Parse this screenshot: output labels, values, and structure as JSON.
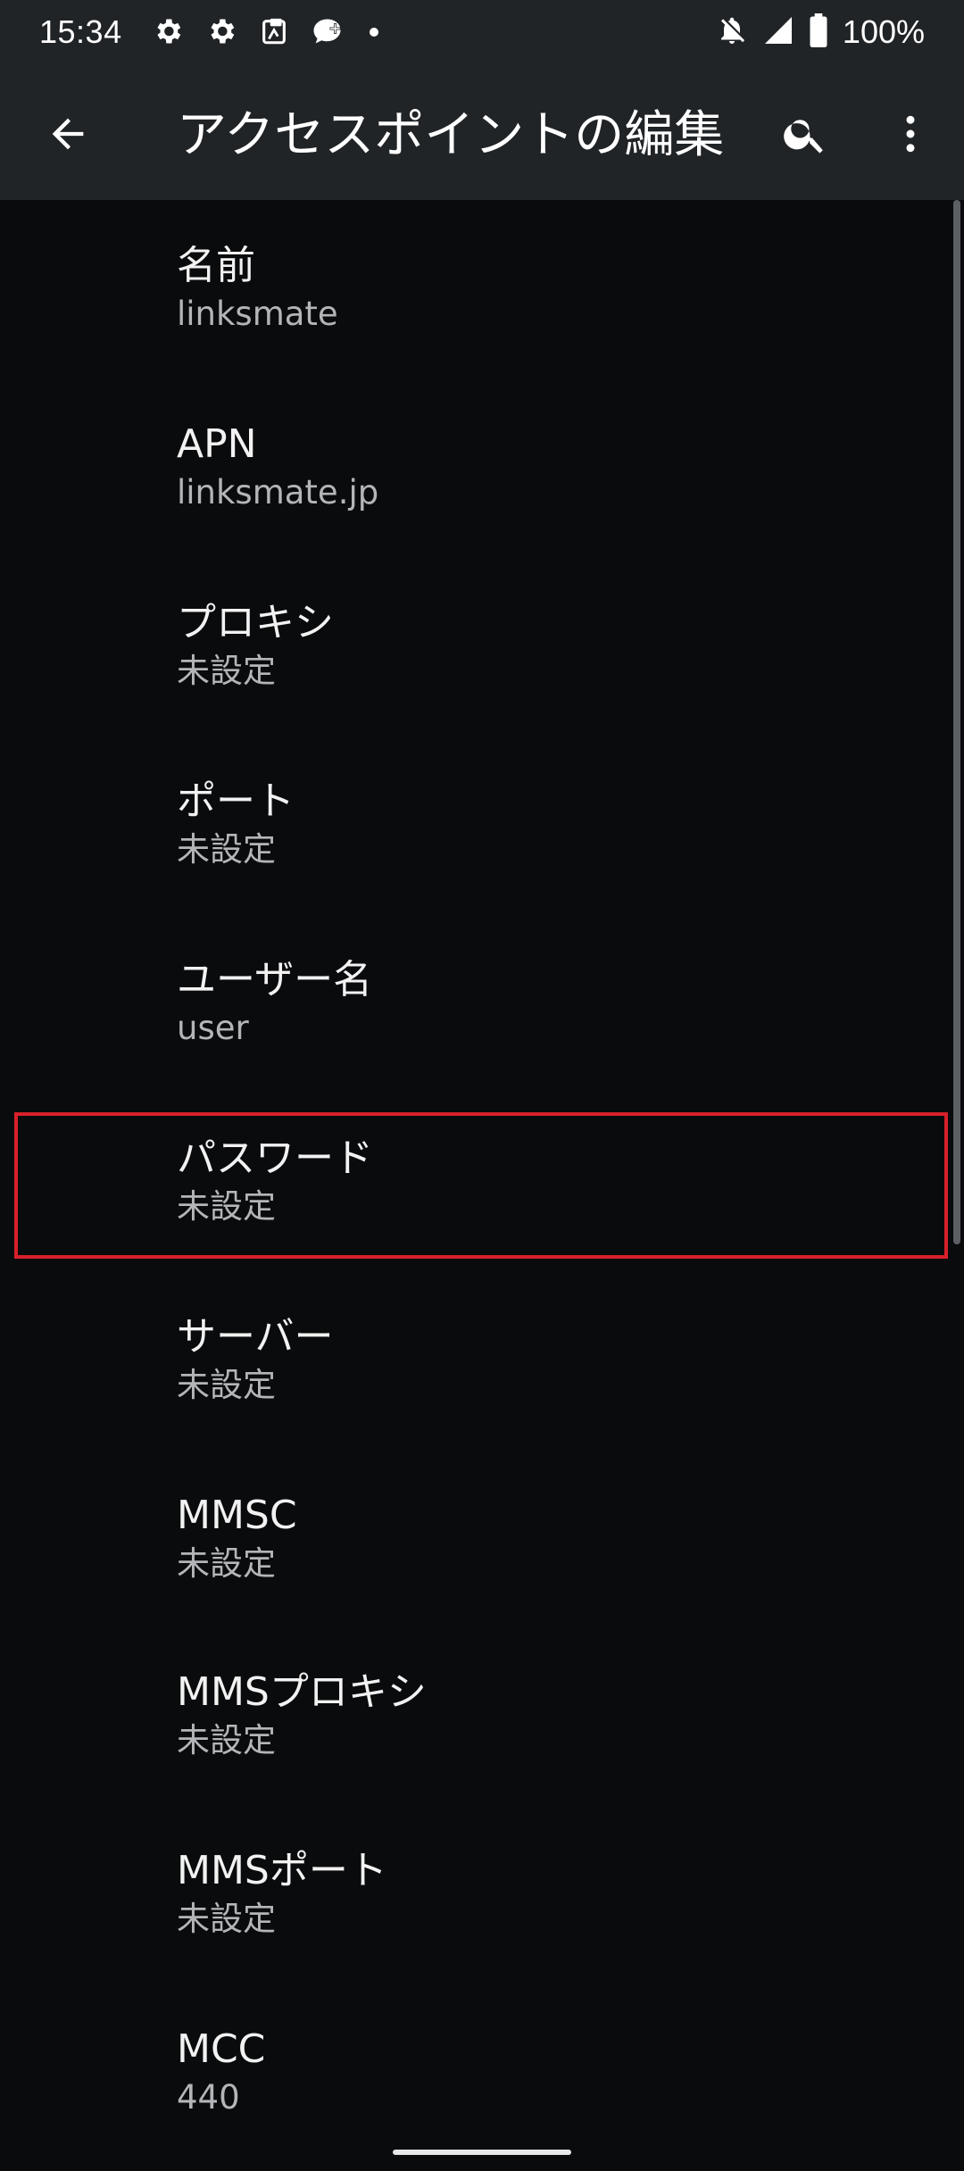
{
  "status_bar": {
    "time": "15:34",
    "left_icons": [
      "settings-icon",
      "settings-icon",
      "clipboard-icon",
      "chat-plus-icon",
      "notification-dot-icon"
    ],
    "right_icons": [
      "notifications-off-icon",
      "cell-signal-icon",
      "battery-icon"
    ],
    "battery_text": "100%"
  },
  "app_bar": {
    "back_icon": "arrow-back-icon",
    "title": "アクセスポイントの編集",
    "search_icon": "search-icon",
    "more_icon": "more-vertical-icon"
  },
  "settings": [
    {
      "title": "名前",
      "value": "linksmate"
    },
    {
      "title": "APN",
      "value": "linksmate.jp"
    },
    {
      "title": "プロキシ",
      "value": "未設定"
    },
    {
      "title": "ポート",
      "value": "未設定"
    },
    {
      "title": "ユーザー名",
      "value": "user"
    },
    {
      "title": "パスワード",
      "value": "未設定"
    },
    {
      "title": "サーバー",
      "value": "未設定"
    },
    {
      "title": "MMSC",
      "value": "未設定"
    },
    {
      "title": "MMSプロキシ",
      "value": "未設定"
    },
    {
      "title": "MMSポート",
      "value": "未設定"
    },
    {
      "title": "MCC",
      "value": "440"
    }
  ],
  "highlighted_setting": "パスワード",
  "colors": {
    "background": "#0a0b0d",
    "bar": "#212427",
    "highlight": "#d8202a",
    "title_text": "#f2f2f2",
    "value_text": "#b3b5b8"
  }
}
